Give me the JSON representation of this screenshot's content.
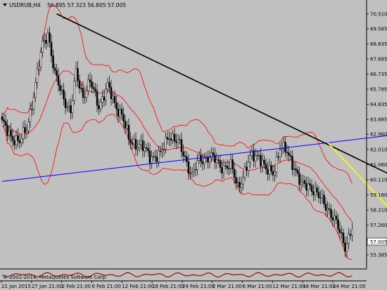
{
  "window": {
    "symbol": "USDRUB,H4",
    "ohlc": "56.895 57.323 56.805 57.005",
    "last_price": "57.005",
    "copyright": "© 2001-2014, MetaQuotes Software Corp."
  },
  "colors": {
    "background": "#c0c0c0",
    "bull_candle": "#ffffff",
    "bear_candle": "#000000",
    "bollinger": "#ff0000",
    "resistance_line": "#000000",
    "support_line": "#0000ff",
    "short_trend_line": "#ffff00",
    "price_label_bg": "#ffffff"
  },
  "chart_data": {
    "type": "candlestick",
    "x_ticks": [
      "21 Jan 2015",
      "27 Jan 21:00",
      "2 Feb 21:00",
      "6 Feb 21:00",
      "12 Feb 21:00",
      "18 Feb 21:00",
      "24 Feb 21:00",
      "2 Mar 21:00",
      "6 Mar 21:00",
      "12 Mar 21:00",
      "18 Mar 21:00",
      "24 Mar 21:00"
    ],
    "y_ticks": [
      "70.510",
      "69.585",
      "68.635",
      "67.685",
      "66.735",
      "65.785",
      "64.835",
      "63.885",
      "62.960",
      "62.010",
      "61.060",
      "60.110",
      "59.160",
      "58.210",
      "57.260",
      "56.335",
      "55.385"
    ],
    "ylim": [
      55.385,
      70.51
    ],
    "bar_count": 200,
    "close_anchors": [
      {
        "bar": 0,
        "close": 63.6
      },
      {
        "bar": 5,
        "close": 62.9
      },
      {
        "bar": 10,
        "close": 62.4
      },
      {
        "bar": 14,
        "close": 63.4
      },
      {
        "bar": 18,
        "close": 65.4
      },
      {
        "bar": 23,
        "close": 68.6
      },
      {
        "bar": 26,
        "close": 69.4
      },
      {
        "bar": 30,
        "close": 66.6
      },
      {
        "bar": 35,
        "close": 65.3
      },
      {
        "bar": 39,
        "close": 64.3
      },
      {
        "bar": 42,
        "close": 66.8
      },
      {
        "bar": 46,
        "close": 65.4
      },
      {
        "bar": 50,
        "close": 66.2
      },
      {
        "bar": 55,
        "close": 64.8
      },
      {
        "bar": 60,
        "close": 65.9
      },
      {
        "bar": 64,
        "close": 64.9
      },
      {
        "bar": 68,
        "close": 64.2
      },
      {
        "bar": 72,
        "close": 62.6
      },
      {
        "bar": 78,
        "close": 62.3
      },
      {
        "bar": 84,
        "close": 61.6
      },
      {
        "bar": 90,
        "close": 61.6
      },
      {
        "bar": 95,
        "close": 63.0
      },
      {
        "bar": 100,
        "close": 62.4
      },
      {
        "bar": 104,
        "close": 61.5
      },
      {
        "bar": 108,
        "close": 60.4
      },
      {
        "bar": 112,
        "close": 61.3
      },
      {
        "bar": 118,
        "close": 61.6
      },
      {
        "bar": 124,
        "close": 61.0
      },
      {
        "bar": 130,
        "close": 60.9
      },
      {
        "bar": 134,
        "close": 59.7
      },
      {
        "bar": 138,
        "close": 60.6
      },
      {
        "bar": 142,
        "close": 61.6
      },
      {
        "bar": 146,
        "close": 61.7
      },
      {
        "bar": 150,
        "close": 60.6
      },
      {
        "bar": 154,
        "close": 60.6
      },
      {
        "bar": 158,
        "close": 62.1
      },
      {
        "bar": 162,
        "close": 61.8
      },
      {
        "bar": 166,
        "close": 61.0
      },
      {
        "bar": 170,
        "close": 59.7
      },
      {
        "bar": 175,
        "close": 59.8
      },
      {
        "bar": 180,
        "close": 59.0
      },
      {
        "bar": 185,
        "close": 58.4
      },
      {
        "bar": 190,
        "close": 57.3
      },
      {
        "bar": 195,
        "close": 56.0
      },
      {
        "bar": 199,
        "close": 57.005
      }
    ],
    "indicators": [
      "Bollinger Bands (upper, middle, lower)"
    ],
    "trend_lines": [
      {
        "name": "resistance",
        "color": "black",
        "from": {
          "bar": 31,
          "price": 70.52
        },
        "to": {
          "bar": 231,
          "price": 59.88
        }
      },
      {
        "name": "support",
        "color": "blue",
        "from": {
          "bar": 0,
          "price": 60.0
        },
        "to": {
          "bar": 221,
          "price": 62.9
        }
      },
      {
        "name": "short-downtrend",
        "color": "yellow",
        "from": {
          "bar": 185,
          "price": 62.45
        },
        "to": {
          "bar": 229,
          "price": 57.27
        }
      }
    ],
    "grid": false
  }
}
